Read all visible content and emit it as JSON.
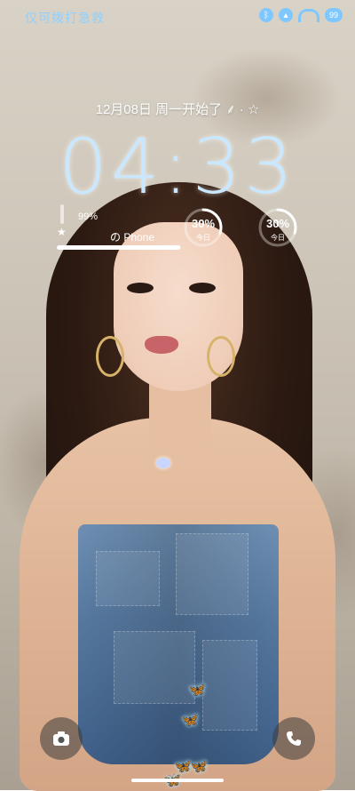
{
  "status_bar": {
    "carrier": "仅可拨打急救",
    "icons": [
      "bluetooth-icon",
      "signal-icon",
      "wifi-icon",
      "battery-icon"
    ],
    "battery_badge": "99"
  },
  "lock_screen": {
    "date_line": "12月08日  周一开始了 ⸙ · ☆",
    "time": "04:33"
  },
  "battery_widget": {
    "percent_label": "99%",
    "percent_value": 0.99,
    "star_glyph": "★",
    "device_label": "の Phone"
  },
  "ring_widgets": [
    {
      "percent_label": "30%",
      "value": 0.3,
      "sub_label": "今日",
      "color": "#ffffff"
    },
    {
      "percent_label": "30%",
      "value": 0.3,
      "sub_label": "今日",
      "color": "#ffffff"
    }
  ],
  "controls": {
    "camera_icon": "camera-icon",
    "phone_icon": "phone-icon"
  },
  "colors": {
    "accent": "#8fd0ff",
    "clock": "#c9e8ff"
  }
}
